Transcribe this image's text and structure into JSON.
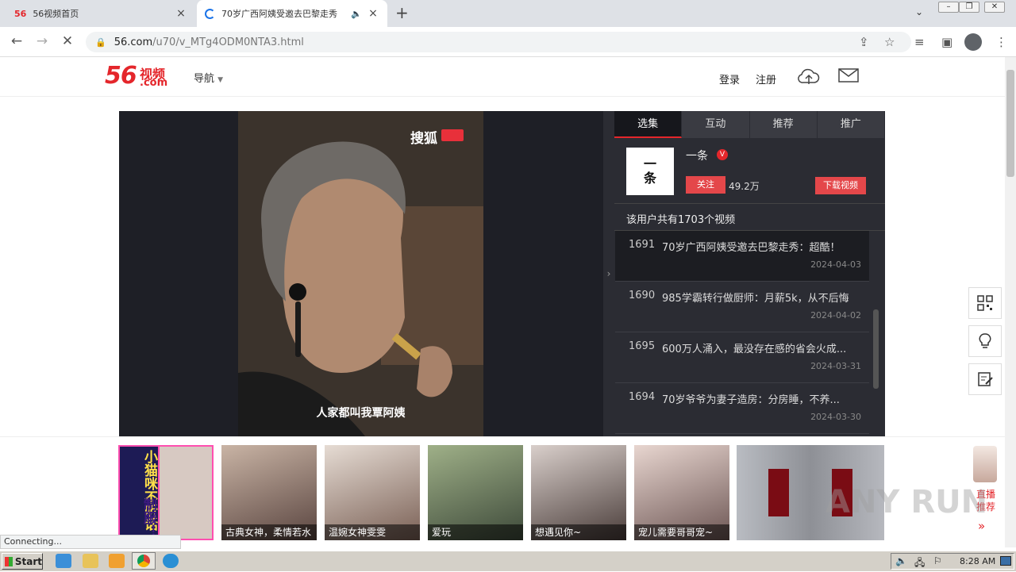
{
  "browser": {
    "tabs": [
      {
        "title": "56视频首页"
      },
      {
        "title": "70岁广西阿姨受邀去巴黎走秀"
      }
    ],
    "url_host": "56.com",
    "url_path": "/u70/v_MTg4ODM0NTA3.html",
    "status_text": "Connecting..."
  },
  "site": {
    "logo_num": "56",
    "logo_cn": "视频",
    "logo_com": ".com",
    "nav_label": "导航",
    "login": "登录",
    "register": "注册"
  },
  "player": {
    "watermark_brand": "搜狐",
    "subtitle": "人家都叫我覃阿姨"
  },
  "panel": {
    "tabs": [
      "选集",
      "互动",
      "推荐",
      "推广"
    ],
    "avatar_text_1": "一",
    "avatar_text_2": "条",
    "user_name": "一条",
    "verified_badge": "V",
    "follow_label": "关注",
    "fans": "49.2万",
    "download_label": "下载视频",
    "video_count": "该用户共有1703个视频",
    "episodes": [
      {
        "num": "1691",
        "title": "70岁广西阿姨受邀去巴黎走秀：超酷！",
        "date": "2024-04-03"
      },
      {
        "num": "1690",
        "title": "985学霸转行做厨师：月薪5k，从不后悔",
        "date": "2024-04-02"
      },
      {
        "num": "1695",
        "title": "600万人涌入，最没存在感的省会火成...",
        "date": "2024-03-31"
      },
      {
        "num": "1694",
        "title": "70岁爷爷为妻子造房：分房睡，不养...",
        "date": "2024-03-30"
      }
    ]
  },
  "banner": {
    "ad_text": "小猫咪不听话",
    "ad_text2": "制服！",
    "items": [
      {
        "caption": "古典女神，柔情若水"
      },
      {
        "caption": "温婉女神雯雯"
      },
      {
        "caption": "爱玩"
      },
      {
        "caption": "想遇见你~"
      },
      {
        "caption": "宠儿需要哥哥宠~"
      },
      {
        "caption": ""
      }
    ],
    "live_label_1": "直播",
    "live_label_2": "推荐",
    "live_arrow": "»"
  },
  "watermark": "ANY RUN",
  "taskbar": {
    "start_label": "Start",
    "clock": "8:28 AM"
  },
  "colors": {
    "brand": "#e4262b",
    "panel_bg": "#2b2c33",
    "button_red": "#e4474a"
  }
}
